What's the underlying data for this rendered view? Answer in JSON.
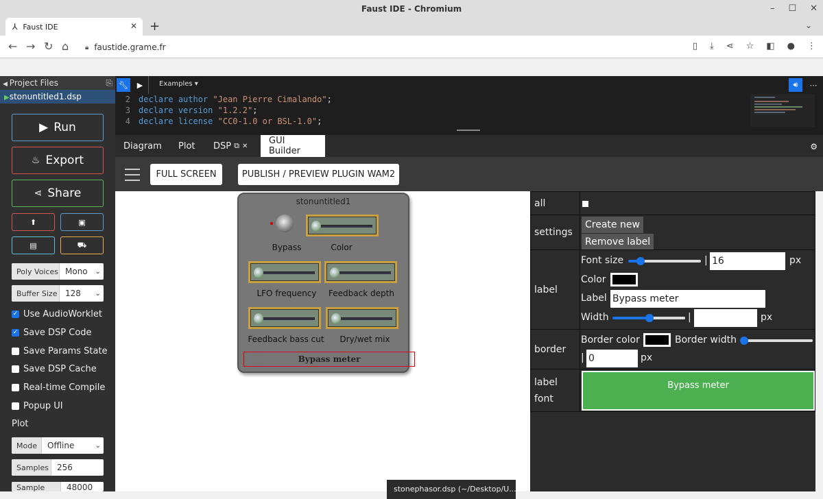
{
  "window": {
    "title": "Faust IDE - Chromium",
    "minimize": "–",
    "maximize": "☐",
    "close": "✕"
  },
  "tab": {
    "title": "Faust IDE",
    "close": "✕",
    "new_tab": "+",
    "menu": "⌄"
  },
  "browser": {
    "url": "faustide.grame.fr"
  },
  "sidebar": {
    "header": "Project Files",
    "file": "stonuntitled1.dsp",
    "run": "Run",
    "export": "Export",
    "share": "Share",
    "poly_voices_label": "Poly Voices",
    "poly_voices_value": "Mono",
    "buffer_size_label": "Buffer Size",
    "buffer_size_value": "128",
    "checkboxes": [
      {
        "label": "Use AudioWorklet",
        "checked": true
      },
      {
        "label": "Save DSP Code",
        "checked": true
      },
      {
        "label": "Save Params State",
        "checked": false
      },
      {
        "label": "Save DSP Cache",
        "checked": false
      },
      {
        "label": "Real-time Compile",
        "checked": false
      },
      {
        "label": "Popup UI",
        "checked": false
      }
    ],
    "plot_title": "Plot",
    "mode_label": "Mode",
    "mode_value": "Offline",
    "samples_label": "Samples",
    "samples_value": "256",
    "sample_rate_label": "Sample Rate",
    "sample_rate_value": "48000"
  },
  "editor": {
    "examples": "Examples ▾",
    "lines": [
      {
        "num": "2",
        "kw1": "declare",
        "kw2": "author",
        "str": "\"Jean Pierre Cimalando\"",
        "end": ";"
      },
      {
        "num": "3",
        "kw1": "declare",
        "kw2": "version",
        "str": "\"1.2.2\"",
        "end": ";"
      },
      {
        "num": "4",
        "kw1": "declare",
        "kw2": "license",
        "str": "\"CC0-1.0 or BSL-1.0\"",
        "end": ";"
      }
    ]
  },
  "panel_tabs": [
    "Diagram",
    "Plot",
    "DSP",
    "GUI Builder"
  ],
  "gui_builder": {
    "full_screen": "FULL SCREEN",
    "publish": "PUBLISH / PREVIEW PLUGIN WAM2",
    "plugin_name": "stonuntitled1",
    "controls": {
      "bypass": "Bypass",
      "color": "Color",
      "lfo": "LFO frequency",
      "feedback_depth": "Feedback depth",
      "feedback_bass": "Feedback bass cut",
      "drywet": "Dry/wet mix",
      "meter": "Bypass meter"
    },
    "window_thumb": "stonephasor.dsp (~/Desktop/U..."
  },
  "properties": {
    "all_label": "all",
    "settings_label": "settings",
    "create_new": "Create new",
    "remove_label": "Remove label",
    "label_label": "label",
    "font_size_label": "Font size",
    "font_size_value": "16",
    "px": "px",
    "color_label": "Color",
    "label_field_label": "Label",
    "label_value": "Bypass meter",
    "width_label": "Width",
    "border_label": "border",
    "border_color_label": "Border color",
    "border_width_label": "Border width",
    "border_width_value": "0",
    "label_font_label": "label font",
    "font_preview": "Bypass meter",
    "separator": "|"
  }
}
